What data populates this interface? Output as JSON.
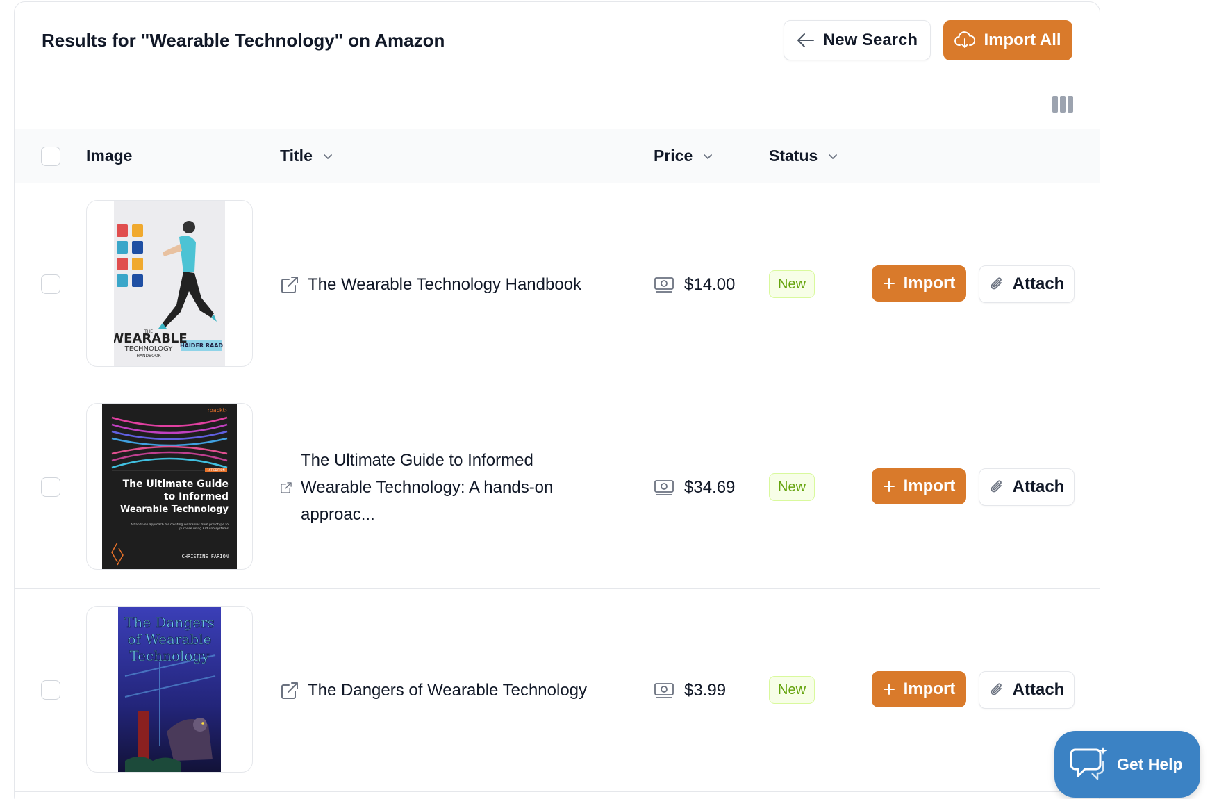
{
  "header": {
    "title": "Results for \"Wearable Technology\" on Amazon",
    "new_search_label": "New Search",
    "import_all_label": "Import All"
  },
  "table": {
    "columns": {
      "image": "Image",
      "title": "Title",
      "price": "Price",
      "status": "Status"
    },
    "rows": [
      {
        "title": "The Wearable Technology Handbook",
        "price": "$14.00",
        "status": "New",
        "import_label": "Import",
        "attach_label": "Attach",
        "cover": {
          "line1": "THE",
          "line2": "WEARABLE",
          "line3": "TECHNOLOGY",
          "line4": "HANDBOOK",
          "author": "HAIDER RAAD"
        }
      },
      {
        "title": "The Ultimate Guide to Informed Wearable Technology: A hands-on approac...",
        "price": "$34.69",
        "status": "New",
        "import_label": "Import",
        "attach_label": "Attach",
        "cover": {
          "publisher": "‹packt›",
          "edition": "1ST EDITION",
          "line1": "The Ultimate Guide",
          "line2": "to Informed",
          "line3": "Wearable Technology",
          "subtitle": "A hands-on approach for creating wearables from prototype to purpose using Arduino systems",
          "author": "CHRISTINE FARION"
        }
      },
      {
        "title": "The Dangers of Wearable Technology",
        "price": "$3.99",
        "status": "New",
        "import_label": "Import",
        "attach_label": "Attach",
        "cover": {
          "line1": "The Dangers",
          "line2": "of Wearable",
          "line3": "Technology"
        }
      }
    ]
  },
  "help": {
    "label": "Get Help"
  },
  "colors": {
    "accent": "#d97a2b",
    "help_bg": "#3b82c4",
    "badge_text": "#65a30d"
  }
}
